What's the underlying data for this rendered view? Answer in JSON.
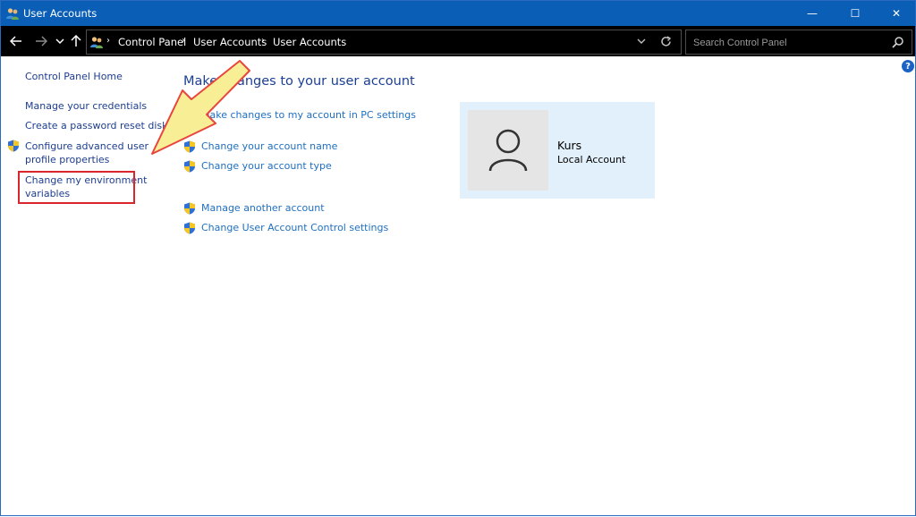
{
  "window": {
    "title": "User Accounts"
  },
  "titlebar": {
    "minimize_glyph": "—",
    "maximize_glyph": "☐",
    "close_glyph": "✕"
  },
  "address": {
    "breadcrumbs": [
      "Control Panel",
      "User Accounts",
      "User Accounts"
    ],
    "separator": "›"
  },
  "search": {
    "placeholder": "Search Control Panel"
  },
  "help": {
    "glyph": "?"
  },
  "left_pane": {
    "items": [
      {
        "label": "Control Panel Home"
      },
      {
        "label": "Manage your credentials"
      },
      {
        "label": "Create a password reset disk"
      },
      {
        "label": "Configure advanced user profile properties",
        "line1": "Configure advanced user",
        "line2": "profile properties"
      },
      {
        "label": "Change my environment variables",
        "line1": "Change my environment",
        "line2": "variables"
      }
    ]
  },
  "main": {
    "heading": "Make changes to your user account",
    "links": [
      "Make changes to my account in PC settings",
      "Change your account name",
      "Change your account type",
      "Manage another account",
      "Change User Account Control settings"
    ]
  },
  "account": {
    "name": "Kurs",
    "type": "Local Account"
  },
  "icons": [
    "users-icon",
    "shield-icon",
    "search-icon",
    "user-avatar-icon",
    "help-icon",
    "refresh-icon"
  ],
  "colors": {
    "titlebar": "#0a5eb5",
    "link": "#1f6fc0",
    "heading": "#1c3f94",
    "highlight": "#d8262c",
    "tile": "#e2f0fb",
    "arrow_fill": "#f8ee96",
    "arrow_stroke": "#e8463d"
  }
}
